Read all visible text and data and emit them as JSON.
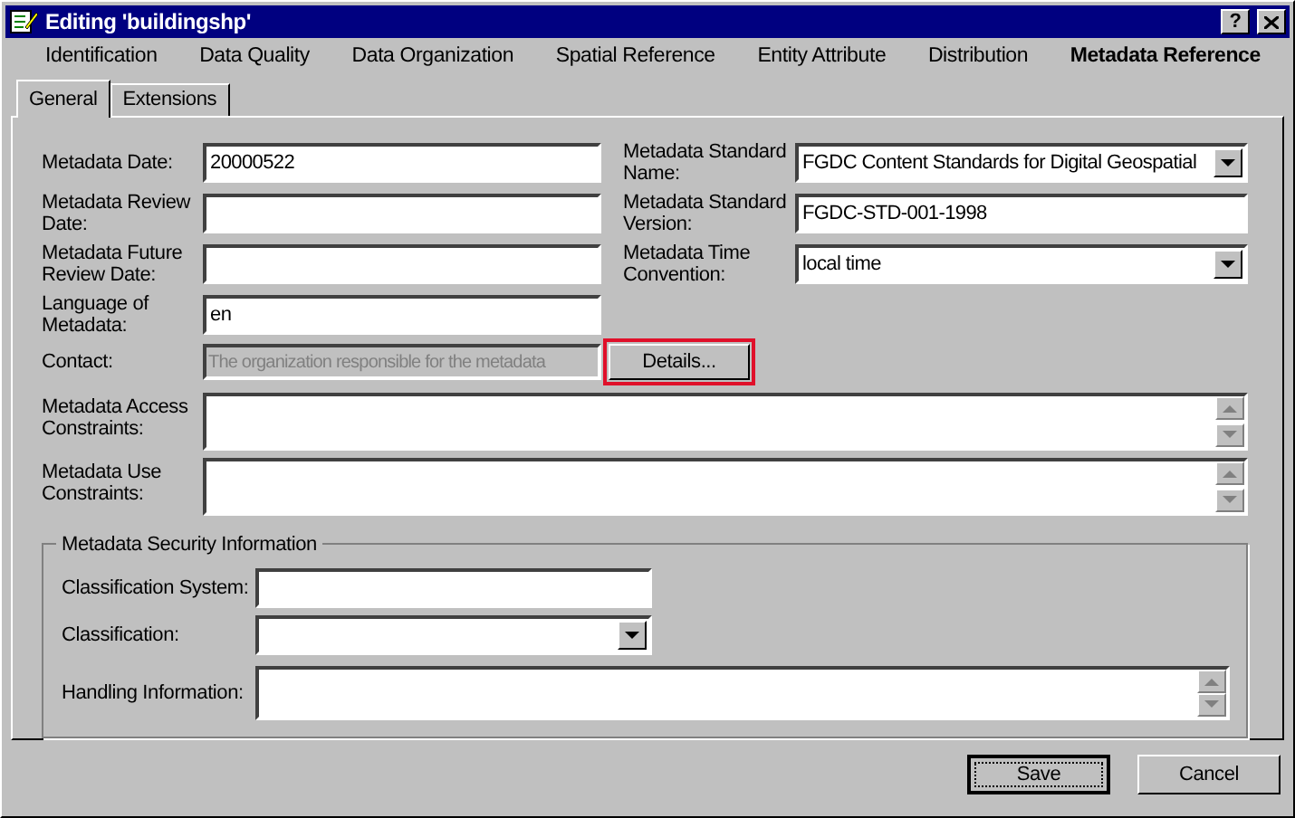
{
  "window": {
    "title": "Editing 'buildingshp'",
    "help_button": "?"
  },
  "sections": [
    {
      "label": "Identification",
      "selected": false
    },
    {
      "label": "Data Quality",
      "selected": false
    },
    {
      "label": "Data Organization",
      "selected": false
    },
    {
      "label": "Spatial Reference",
      "selected": false
    },
    {
      "label": "Entity Attribute",
      "selected": false
    },
    {
      "label": "Distribution",
      "selected": false
    },
    {
      "label": "Metadata Reference",
      "selected": true
    }
  ],
  "tabs": [
    {
      "label": "General",
      "selected": true
    },
    {
      "label": "Extensions",
      "selected": false
    }
  ],
  "left_fields": [
    {
      "label": "Metadata Date:",
      "value": "20000522"
    },
    {
      "label": "Metadata Review Date:"
    },
    {
      "label": "Metadata Future Review Date:"
    },
    {
      "label": "Language of Metadata:",
      "value": "en"
    }
  ],
  "right_fields": [
    {
      "label": "Metadata Standard Name:",
      "kind": "dropdown",
      "value": "FGDC Content Standards for Digital Geospatial"
    },
    {
      "label": "Metadata Standard Version:",
      "kind": "text",
      "value": "FGDC-STD-001-1998"
    },
    {
      "label": "Metadata Time Convention:",
      "kind": "dropdown",
      "value": "local time"
    }
  ],
  "contact": {
    "label": "Contact:",
    "value": "The organization responsible for the metadata",
    "disabled": true,
    "button": "Details...",
    "highlighted": true
  },
  "memo_fields": [
    {
      "label": "Metadata Access Constraints:"
    },
    {
      "label": "Metadata Use Constraints:"
    }
  ],
  "security": {
    "title": "Metadata Security Information",
    "fields": [
      {
        "label": "Classification System:",
        "kind": "text"
      },
      {
        "label": "Classification:",
        "kind": "dropdown"
      },
      {
        "label": "Handling Information:",
        "kind": "memo"
      }
    ]
  },
  "buttons": [
    {
      "label": "Save",
      "default": true
    },
    {
      "label": "Cancel",
      "default": false
    }
  ]
}
